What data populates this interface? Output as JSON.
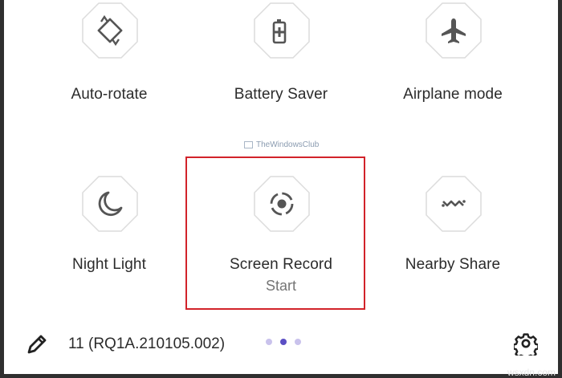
{
  "tiles": [
    {
      "label": "Auto-rotate",
      "icon": "auto-rotate-icon"
    },
    {
      "label": "Battery Saver",
      "icon": "battery-saver-icon"
    },
    {
      "label": "Airplane mode",
      "icon": "airplane-icon"
    },
    {
      "label": "Night Light",
      "icon": "night-light-icon"
    },
    {
      "label": "Screen Record",
      "sublabel": "Start",
      "icon": "screen-record-icon"
    },
    {
      "label": "Nearby Share",
      "icon": "nearby-share-icon"
    }
  ],
  "footer": {
    "build": "11 (RQ1A.210105.002)",
    "pages": 3,
    "current_page": 2,
    "edit_icon": "pencil-icon",
    "settings_icon": "gear-icon"
  },
  "watermark": "TheWindowsClub",
  "site_mark": "wsxdn.com",
  "colors": {
    "highlight": "#d2232a",
    "page_dot_active": "#5b4fc4",
    "page_dot_inactive": "#c9c2ec",
    "tile_outline": "#dcdcdc",
    "icon": "#555555"
  }
}
